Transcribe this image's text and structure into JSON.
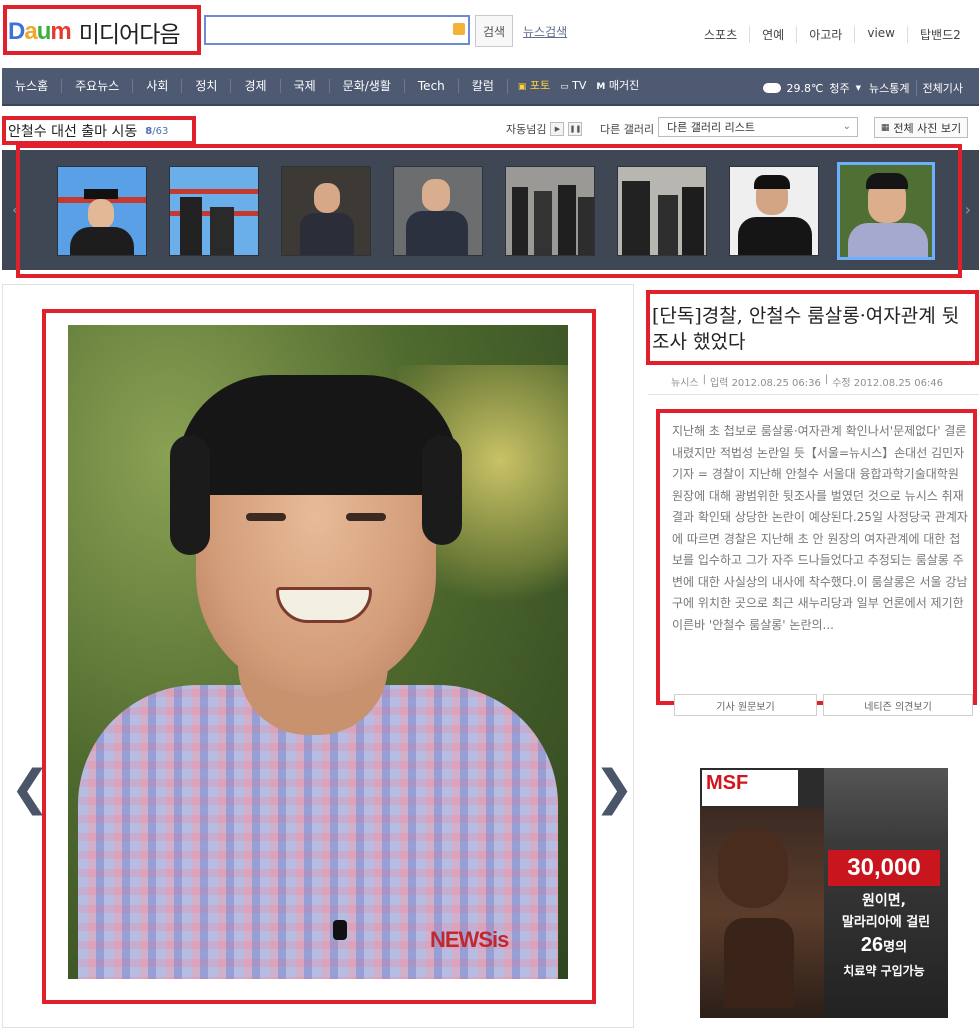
{
  "header": {
    "logo_brand": "Daum",
    "logo_text": "미디어다음",
    "search_placeholder": "",
    "search_button": "검색",
    "news_search": "뉴스검색",
    "top_links": [
      "스포츠",
      "연예",
      "아고라",
      "view",
      "탑밴드2"
    ]
  },
  "nav": {
    "items": [
      "뉴스홈",
      "주요뉴스",
      "사회",
      "정치",
      "경제",
      "국제",
      "문화/생활",
      "Tech",
      "칼럼"
    ],
    "media": [
      "포토",
      "TV",
      "매거진"
    ],
    "active": "포토",
    "weather_temp": "29.8℃",
    "weather_city": "청주",
    "right_links": [
      "뉴스통계",
      "전체기사"
    ]
  },
  "gallery": {
    "title": "안철수 대선 출마 시동",
    "current": "8",
    "total": "/63",
    "autoplay_label": "자동넘김",
    "other_gallery_label": "다른 갤러리",
    "other_gallery_select": "다른 갤러리 리스트",
    "all_photos_button": "전체 사진 보기"
  },
  "article": {
    "headline": "[단독]경찰, 안철수 룸살롱·여자관계 뒷조사 했었다",
    "source": "뉴시스",
    "input_time": "입력 2012.08.25 06:36",
    "modified_time": "수정 2012.08.25 06:46",
    "body": "지난해 초 첩보로 룸살롱·여자관계 확인나서'문제없다' 결론내렸지만 적법성 논란일 듯【서울=뉴시스】손대선 김민자 기자 = 경찰이 지난해 안철수 서울대 융합과학기술대학원 원장에 대해 광범위한 뒷조사를 벌였던 것으로 뉴시스 취재결과 확인돼 상당한 논란이 예상된다.25일 사정당국 관계자에 따르면 경찰은 지난해 초 안 원장의 여자관계에 대한 첩보를 입수하고 그가 자주 드나들었다고 추정되는 룸살롱 주변에 대한 사실상의 내사에 착수했다.이 룸살롱은 서울 강남구에 위치한 곳으로 최근 새누리당과 일부 언론에서 제기한 이른바 '안철수 룸살롱' 논란의...",
    "btn_original": "기사 원문보기",
    "btn_comments": "네티즌 의견보기"
  },
  "photo": {
    "watermark": "NEWSis"
  },
  "ad": {
    "logo": "MSF",
    "amount": "30,000",
    "line1": "원이면,",
    "line2": "말라리아에 걸린",
    "line3_num": "26",
    "line3_text": "명의",
    "line4": "치료약 구입가능"
  },
  "colors": {
    "nav_bg": "#4e5a72",
    "active": "#ffd23a",
    "highlight": "#e0202a",
    "ad_red": "#c9151e"
  }
}
